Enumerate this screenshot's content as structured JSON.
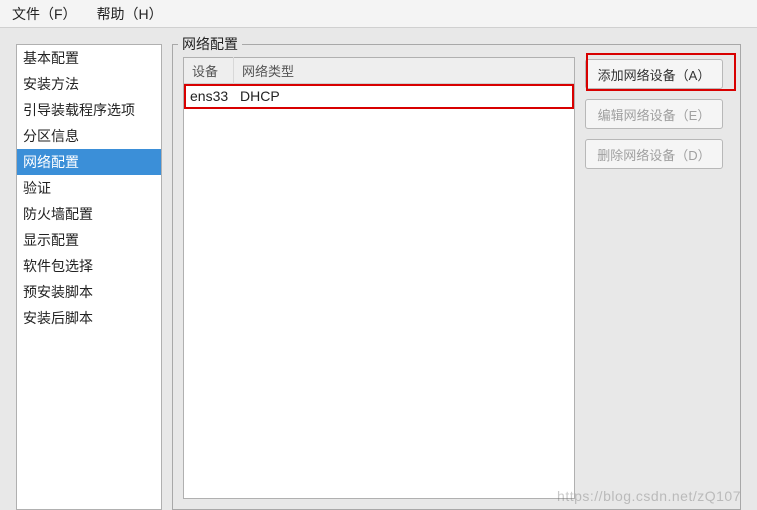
{
  "menubar": {
    "file": "文件（F）",
    "help": "帮助（H）"
  },
  "sidebar": {
    "items": [
      "基本配置",
      "安装方法",
      "引导装载程序选项",
      "分区信息",
      "网络配置",
      "验证",
      "防火墙配置",
      "显示配置",
      "软件包选择",
      "预安装脚本",
      "安装后脚本"
    ],
    "selected_index": 4
  },
  "panel": {
    "title": "网络配置",
    "table": {
      "headers": {
        "device": "设备",
        "type": "网络类型"
      },
      "rows": [
        {
          "device": "ens33",
          "type": "DHCP"
        }
      ]
    },
    "buttons": {
      "add": "添加网络设备（A）",
      "edit": "编辑网络设备（E）",
      "delete": "删除网络设备（D）"
    }
  },
  "watermark": "https://blog.csdn.net/zQ107"
}
